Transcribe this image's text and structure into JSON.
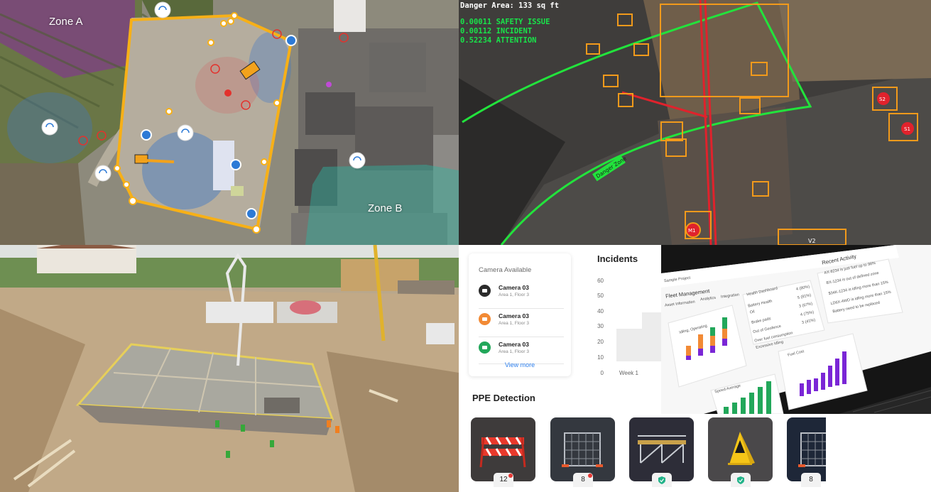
{
  "map": {
    "zone_a": "Zone A",
    "zone_b": "Zone B"
  },
  "danger": {
    "title": "Danger Area: 133 sq ft",
    "lines": [
      "0.00011 SAFETY ISSUE",
      "0.00112 INCIDENT",
      "0.52234 ATTENTION"
    ],
    "zone_tag": "Danger Zone",
    "markers": [
      "S2",
      "S1",
      "M1",
      "V2"
    ],
    "colors": {
      "boundary": "#22e33c",
      "box": "#f29a1b",
      "crane": "#e0222c"
    }
  },
  "dashboard": {
    "cameras": {
      "title": "Camera Available",
      "items": [
        {
          "name": "Camera 03",
          "location": "Area 1, Floor 3",
          "color": "#2b2b2b"
        },
        {
          "name": "Camera 03",
          "location": "Area 1, Floor 3",
          "color": "#f28a35"
        },
        {
          "name": "Camera 03",
          "location": "Area 1, Floor 3",
          "color": "#22a75a"
        }
      ],
      "view_more": "View more"
    },
    "incidents": {
      "title": "Incidents",
      "y_ticks": [
        "60",
        "50",
        "40",
        "30",
        "20",
        "10",
        "0"
      ],
      "week_label": "Week 1"
    },
    "ppe": {
      "title": "PPE Detection",
      "items": [
        {
          "kind": "barrier",
          "count": "12",
          "alert": true
        },
        {
          "kind": "fence",
          "count": "8",
          "alert": true
        },
        {
          "kind": "scaffold",
          "count": "",
          "shield": true
        },
        {
          "kind": "wet-floor-sign",
          "count": "",
          "shield": true
        },
        {
          "kind": "fence",
          "count": "8",
          "alert": false
        }
      ]
    },
    "laptop": {
      "project": "Sample Project",
      "heading": "Fleet Management",
      "tabs": [
        "Asset Information",
        "Analytics",
        "Integration"
      ],
      "idling": "Idling, Operating",
      "speed": "Speed Average",
      "fuel": "Fuel Cost",
      "health": "Health Dashboard",
      "health_items": [
        {
          "label": "Battery Health",
          "value": "4 (80%)"
        },
        {
          "label": "Oil",
          "value": "5 (81%)"
        },
        {
          "label": "Brake pads",
          "value": "3 (67%)"
        },
        {
          "label": "Out of Geofence",
          "value": "4 (75%)"
        },
        {
          "label": "Over fuel consumption",
          "value": "3 (41%)"
        },
        {
          "label": "Excessive Idling",
          "value": ""
        }
      ],
      "activity_title": "Recent Activity",
      "activity": [
        "AX-8234 is just fuel up to 98%",
        "BX-1234 is out of defined zone",
        "$34K-1234 is idling more than 15%",
        "LD6X-4WD is idling more than 15%",
        "Battery need to be replaced"
      ],
      "colors": {
        "operating": "#f28a35",
        "idling": "#22a75a",
        "total": "#7a26d6"
      }
    }
  }
}
